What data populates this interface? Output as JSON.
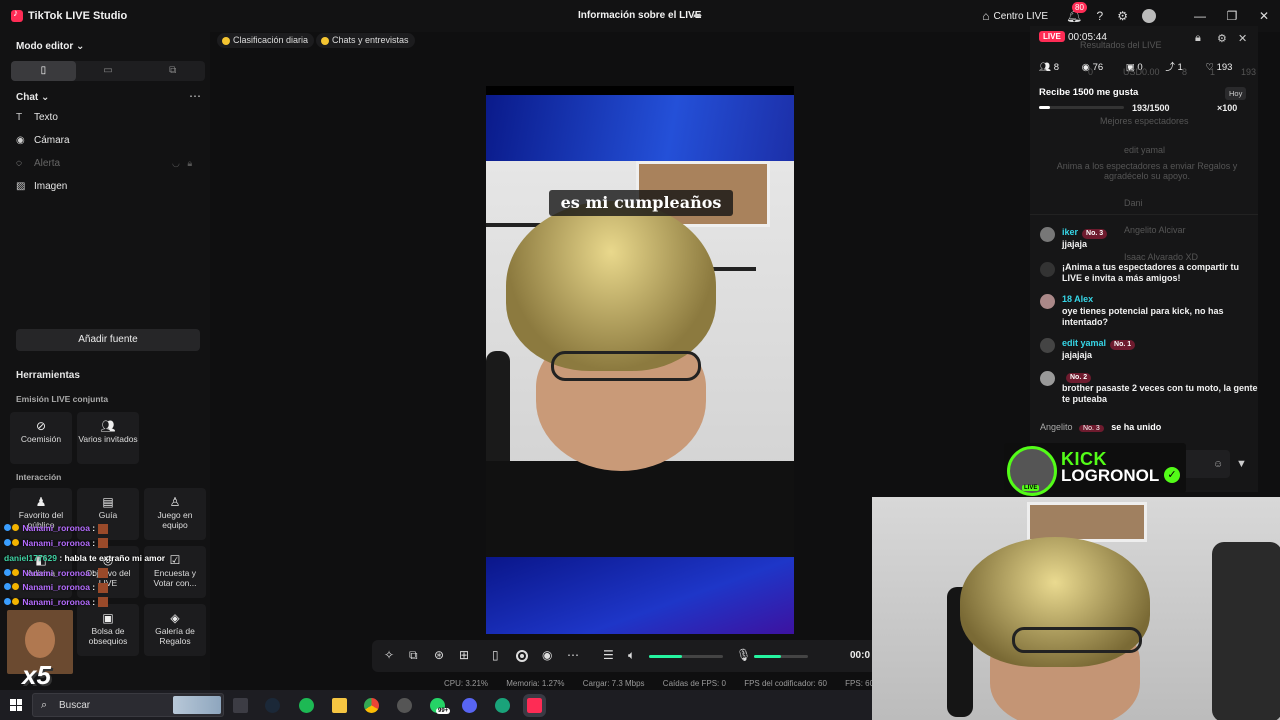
{
  "titlebar": {
    "app_name": "TikTok LIVE Studio",
    "center_title": "Información sobre el LIVE",
    "centro_label": "Centro LIVE",
    "notif_count": "80"
  },
  "left": {
    "editor_mode": "Modo editor",
    "chat_header": "Chat",
    "sources": [
      "Texto",
      "Cámara",
      "Alerta",
      "Imagen"
    ],
    "add_source": "Añadir fuente"
  },
  "tools": {
    "header": "Herramientas",
    "joint_header": "Emisión LIVE conjunta",
    "joint": [
      "Coemisión",
      "Varios invitados"
    ],
    "interaction_header": "Interacción",
    "interaction": [
      "Favorito del público",
      "Guía",
      "Juego en equipo",
      "Adivina",
      "Objetivo del LIVE",
      "Encuesta y Votar con...",
      "Bolsa de obsequios",
      "Galería de Regalos"
    ]
  },
  "overlay_chat": [
    {
      "user": "Nanami_roronoa",
      "msg": ":"
    },
    {
      "user": "Nanami_roronoa",
      "msg": ":"
    },
    {
      "user": "daniel177629",
      "msg": ": habla te extraño mi amor"
    },
    {
      "user": "Nanami_roronoa",
      "msg": ":"
    },
    {
      "user": "Nanami_roronoa",
      "msg": ":"
    },
    {
      "user": "Nanami_roronoa",
      "msg": ":"
    }
  ],
  "meme_multiplier": "x5",
  "chips": [
    "Clasificación diaria",
    "Chats y entrevistas"
  ],
  "preview": {
    "caption": "es mi cumpleaños"
  },
  "controls": {
    "timer": "00:0",
    "mic_level": 0.5,
    "volume_level": 0.45
  },
  "stats": [
    "CPU: 3.21%",
    "Memoria: 1.27%",
    "Cargar: 7.3 Mbps",
    "Caídas de FPS: 0",
    "FPS del codificador: 60",
    "FPS: 60"
  ],
  "live": {
    "badge": "LIVE",
    "time": "00:05:44",
    "ghost_title": "Resultados del LIVE",
    "stats": [
      "8",
      "76",
      "0",
      "1",
      "193"
    ],
    "ghost_stats": [
      "0",
      "USD0.00",
      "8",
      "1",
      "193"
    ],
    "goal_title": "Recibe 1500 me gusta",
    "goal_period": "Hoy",
    "goal_count": "193/1500",
    "goal_progress": 0.129,
    "goal_reward": "×100",
    "ghost_texts": [
      "Mejores espectadores",
      "edit yamal",
      "Anima a los espectadores a enviar Regalos y agradécelo su apoyo.",
      "Dani",
      "Angelito Alcivar",
      "Isaac Alvarado XD"
    ],
    "messages": [
      {
        "user": "iker",
        "rank": "No. 3",
        "text": "jjajaja"
      },
      {
        "user": "",
        "rank": "",
        "text": "¡Anima a tus espectadores a compartir tu LIVE e invita a más amigos!"
      },
      {
        "user": "18   Alex",
        "rank": "",
        "text": "oye tienes potencial para kick, no has intentado?"
      },
      {
        "user": "edit yamal",
        "rank": "No. 1",
        "text": "jajajaja"
      },
      {
        "user": "",
        "rank": "No. 2",
        "text": "brother pasaste 2 veces con tu moto, la gente te puteaba"
      }
    ],
    "joined_user": "Angelito",
    "joined_rank": "No. 3",
    "joined_text": "se ha unido"
  },
  "kick": {
    "brand": "KICK",
    "name": "LOGRONOL",
    "badge": "LIVE"
  },
  "taskbar": {
    "search": "Buscar",
    "badge": "99+"
  },
  "colors": {
    "accent": "#fe2c55",
    "kick_green": "#53fc18",
    "level_green": "#25f4a0"
  }
}
